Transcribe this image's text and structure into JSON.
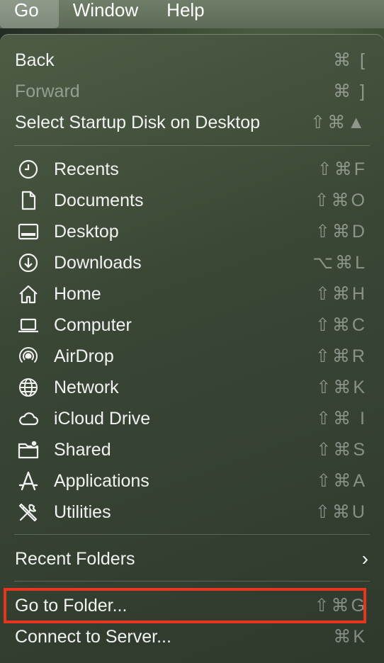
{
  "menubar": {
    "items": [
      {
        "label": "Go"
      },
      {
        "label": "Window"
      },
      {
        "label": "Help"
      }
    ]
  },
  "menu": {
    "top_items": [
      {
        "label": "Back",
        "shortcut": "⌘ ["
      },
      {
        "label": "Forward",
        "shortcut": "⌘ ]",
        "disabled": true
      },
      {
        "label": "Select Startup Disk on Desktop",
        "shortcut": "⇧⌘▲"
      }
    ],
    "places": [
      {
        "label": "Recents",
        "shortcut": "⇧⌘F",
        "icon": "clock-icon"
      },
      {
        "label": "Documents",
        "shortcut": "⇧⌘O",
        "icon": "document-icon"
      },
      {
        "label": "Desktop",
        "shortcut": "⇧⌘D",
        "icon": "desktop-icon"
      },
      {
        "label": "Downloads",
        "shortcut": "⌥⌘L",
        "icon": "download-icon"
      },
      {
        "label": "Home",
        "shortcut": "⇧⌘H",
        "icon": "home-icon"
      },
      {
        "label": "Computer",
        "shortcut": "⇧⌘C",
        "icon": "laptop-icon"
      },
      {
        "label": "AirDrop",
        "shortcut": "⇧⌘R",
        "icon": "airdrop-icon"
      },
      {
        "label": "Network",
        "shortcut": "⇧⌘K",
        "icon": "globe-icon"
      },
      {
        "label": "iCloud Drive",
        "shortcut": "⇧⌘ I",
        "icon": "cloud-icon"
      },
      {
        "label": "Shared",
        "shortcut": "⇧⌘S",
        "icon": "shared-folder-icon"
      },
      {
        "label": "Applications",
        "shortcut": "⇧⌘A",
        "icon": "applications-icon"
      },
      {
        "label": "Utilities",
        "shortcut": "⇧⌘U",
        "icon": "tools-icon"
      }
    ],
    "recent_folders": {
      "label": "Recent Folders",
      "chevron": "›"
    },
    "bottom_items": [
      {
        "label": "Go to Folder...",
        "shortcut": "⇧⌘G"
      },
      {
        "label": "Connect to Server...",
        "shortcut": "⌘K"
      }
    ]
  },
  "colors": {
    "highlight_border": "#e8351e"
  }
}
